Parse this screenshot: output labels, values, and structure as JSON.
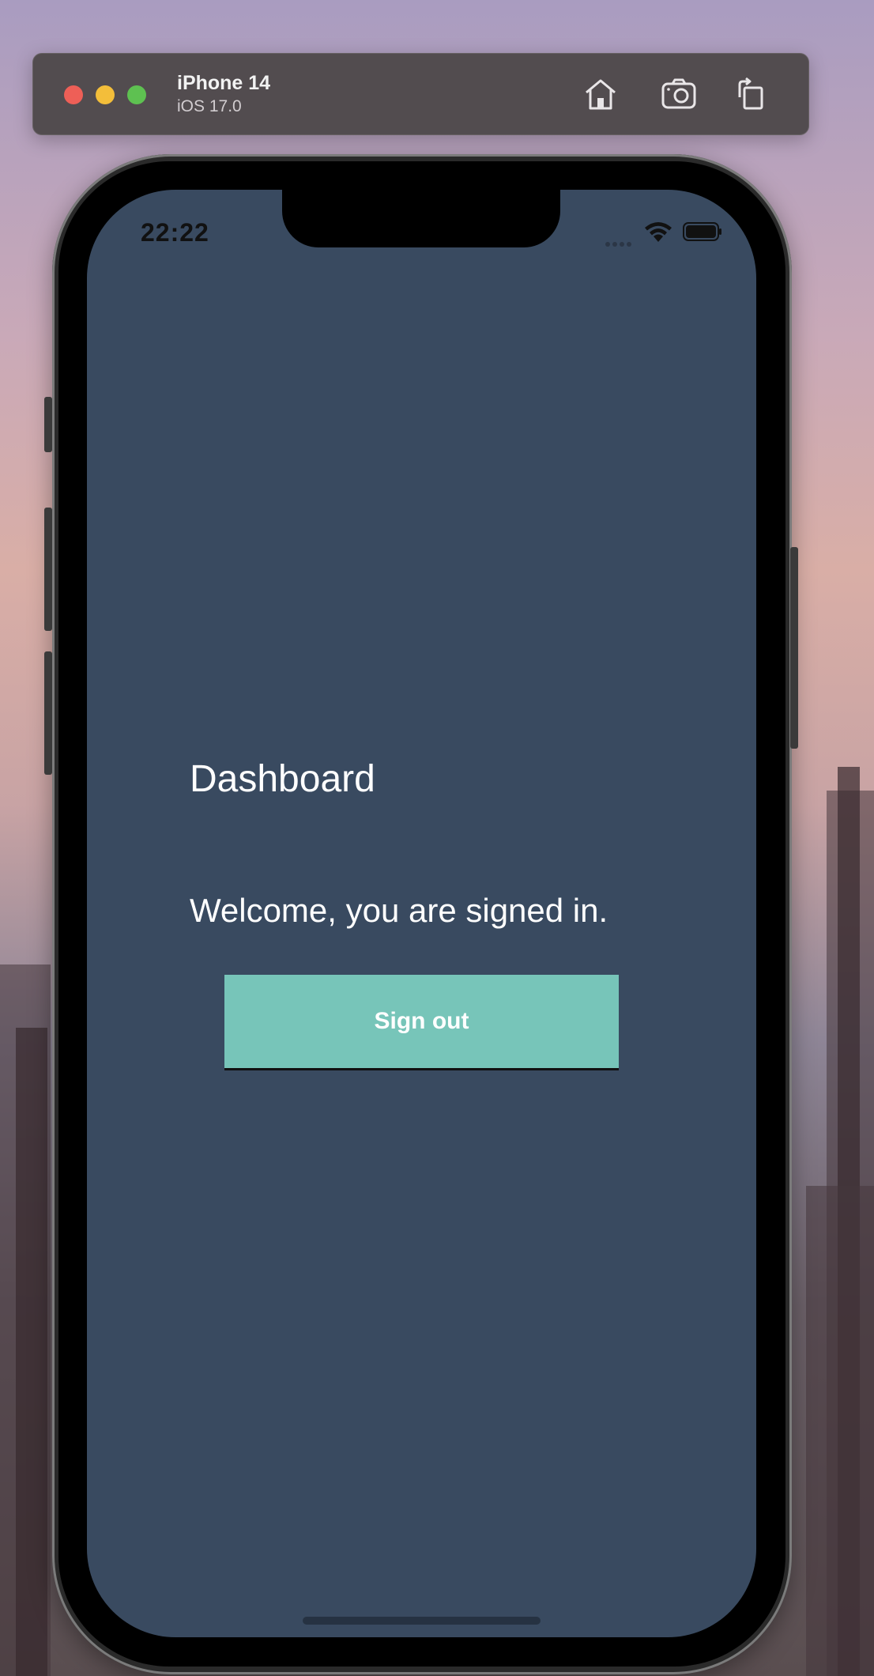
{
  "toolbar": {
    "device_name": "iPhone 14",
    "os_version": "iOS 17.0",
    "icons": [
      "home-icon",
      "screenshot-icon",
      "rotate-icon"
    ]
  },
  "status_bar": {
    "time": "22:22",
    "icons": [
      "cellular-signal-icon",
      "wifi-icon",
      "battery-icon"
    ]
  },
  "app": {
    "title": "Dashboard",
    "message": "Welcome, you are signed in.",
    "sign_out_label": "Sign out",
    "background_color": "#394a60",
    "button_color": "#77c5b9"
  }
}
